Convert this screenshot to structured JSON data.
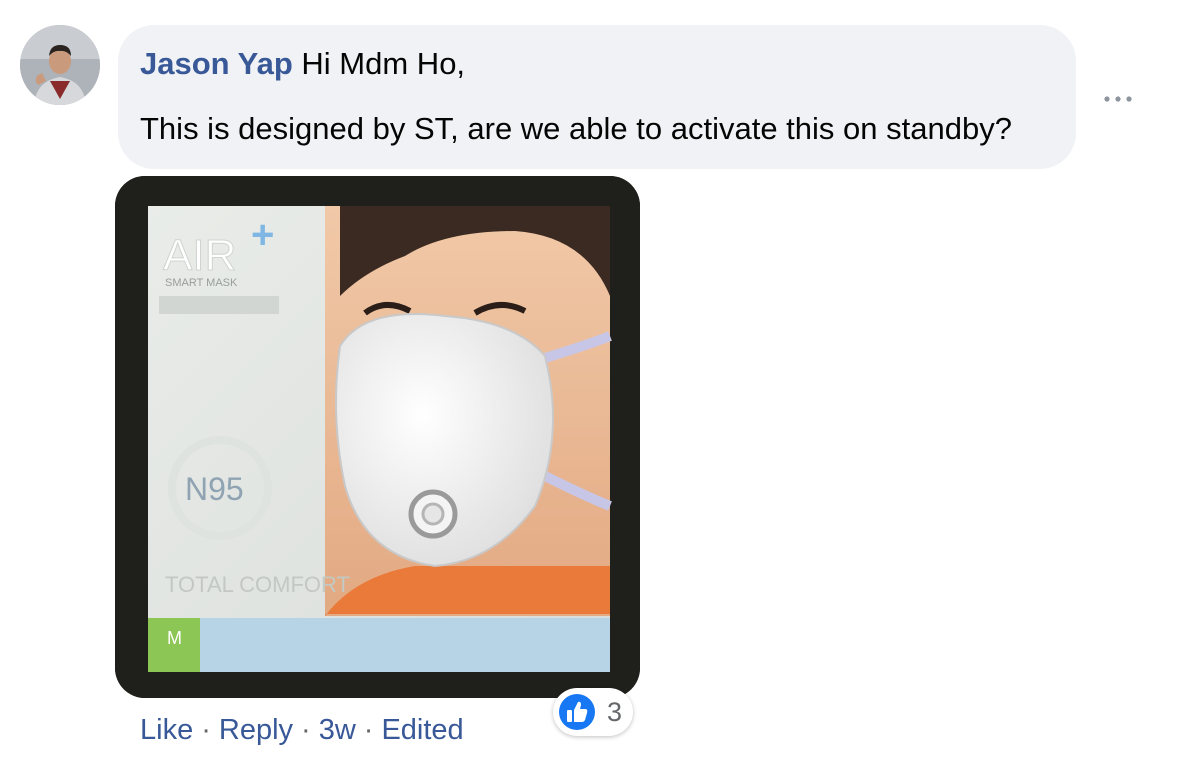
{
  "comment": {
    "author": "Jason Yap",
    "text_line1": "Hi Mdm Ho,",
    "text_line2": "This is designed by ST, are we able to activate this on standby?"
  },
  "photo": {
    "brand": "AIR",
    "brand_mark": "+",
    "product_line": "SMART MASK",
    "certification": "N95",
    "tagline": "TOTAL COMFORT",
    "size": "M"
  },
  "actions": {
    "like_label": "Like",
    "reply_label": "Reply",
    "time": "3w",
    "edited_label": "Edited"
  },
  "reactions": {
    "count": "3"
  },
  "colors": {
    "link": "#385898",
    "bubble": "#f0f2f5",
    "like_blue": "#1877f2",
    "text": "#050505",
    "muted": "#65676b"
  },
  "icons": {
    "more": "more-horizontal-icon",
    "reaction": "like-thumb-icon"
  }
}
